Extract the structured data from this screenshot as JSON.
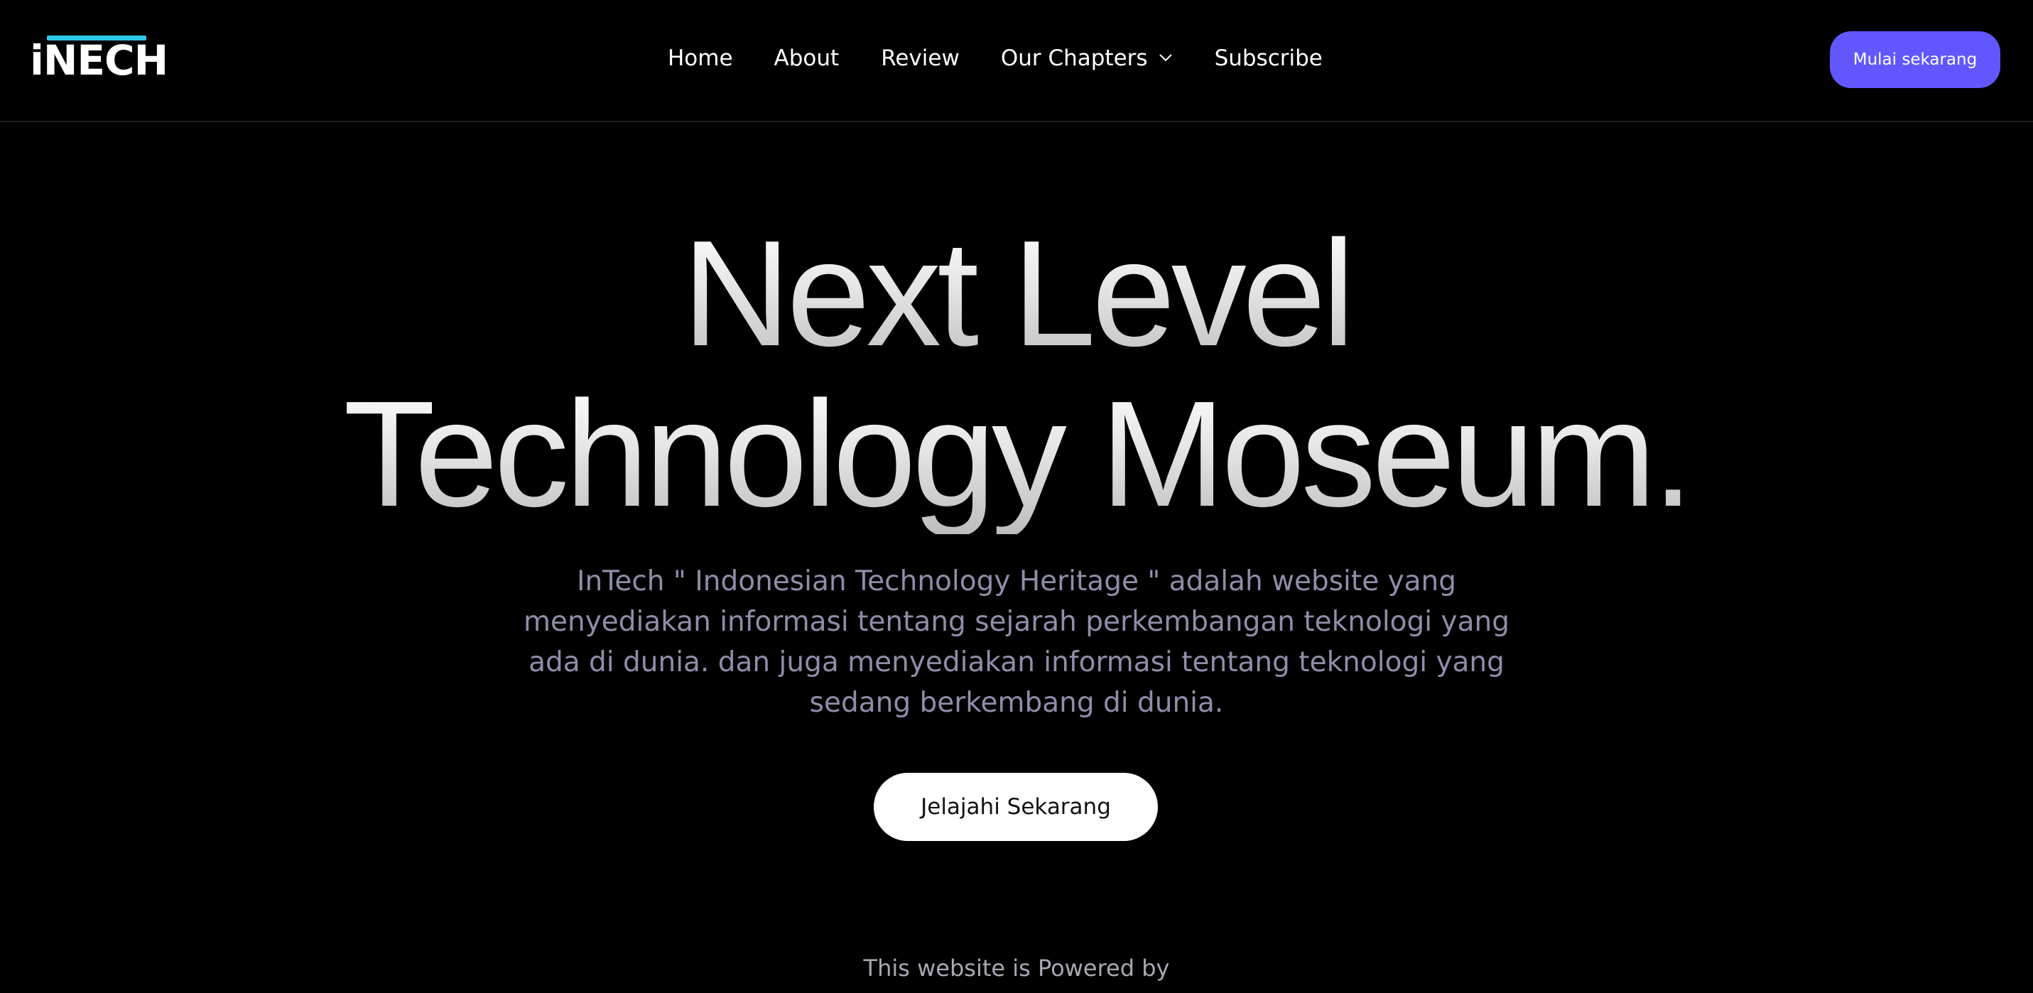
{
  "brand": {
    "logo_text": "iNECH",
    "logo_alt": "InTech",
    "accent_color": "#2ec9e8"
  },
  "nav": {
    "items": [
      {
        "label": "Home"
      },
      {
        "label": "About"
      },
      {
        "label": "Review"
      },
      {
        "label": "Our Chapters",
        "icon": "chevron-down-icon"
      },
      {
        "label": "Subscribe"
      }
    ]
  },
  "header": {
    "cta_label": "Mulai sekarang",
    "cta_color": "#6257ff"
  },
  "hero": {
    "title_line1": "Next Level",
    "title_line2": "Technology Moseum.",
    "description": "InTech \" Indonesian Technology Heritage \" adalah website yang menyediakan informasi tentang sejarah perkembangan teknologi yang ada di dunia. dan juga menyediakan informasi tentang teknologi yang sedang berkembang di dunia.",
    "cta_label": "Jelajahi Sekarang"
  },
  "footer": {
    "powered_text": "This website is Powered by"
  }
}
